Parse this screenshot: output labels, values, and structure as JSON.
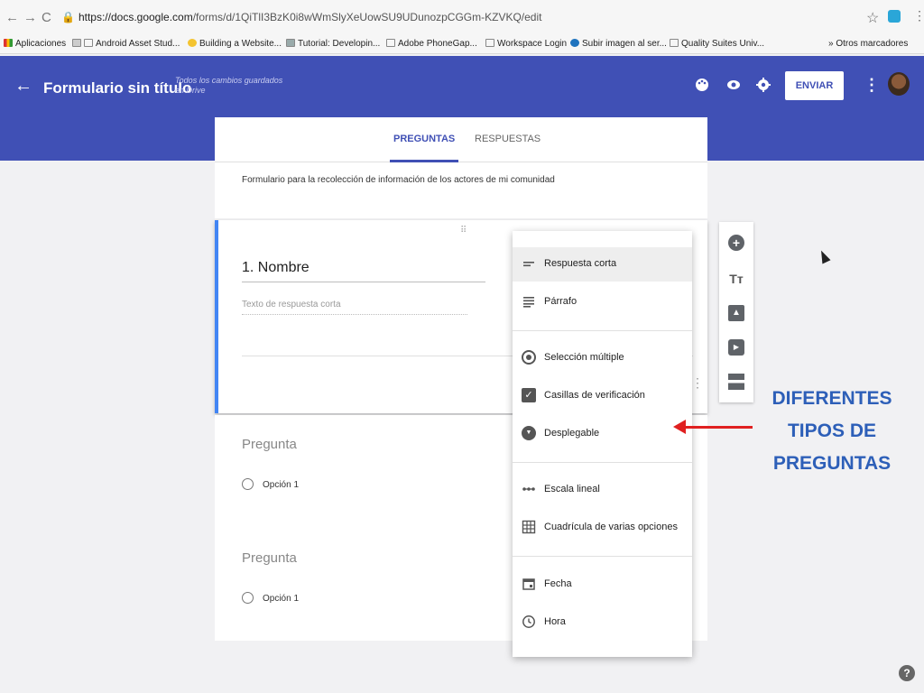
{
  "browser": {
    "url_host": "https://docs.google.com",
    "url_path": "/forms/d/1QiTlI3BzK0i8wWmSlyXeUowSU9UDunozpCGGm-KZVKQ/edit",
    "lock": "🔒",
    "star": "☆",
    "menu": "⋮",
    "nav_back": "←",
    "nav_forward": "→",
    "nav_reload": "C",
    "bookmarks": [
      {
        "label": "Aplicaciones"
      },
      {
        "label": "Android Asset Stud..."
      },
      {
        "label": "Building a Website..."
      },
      {
        "label": "Tutorial: Developin..."
      },
      {
        "label": "Adobe PhoneGap..."
      },
      {
        "label": "Workspace Login"
      },
      {
        "label": "Subir imagen al ser..."
      },
      {
        "label": "Quality Suites Univ..."
      }
    ],
    "other_bookmarks": "» Otros marcadores"
  },
  "header": {
    "back": "←",
    "title": "Formulario sin título",
    "saved_status": "Todos los cambios guardados en Drive",
    "send_label": "ENVIAR",
    "more": "⋮",
    "palette_icon": "palette",
    "preview_icon": "eye",
    "settings_icon": "gear"
  },
  "tabs": {
    "questions": "PREGUNTAS",
    "responses": "RESPUESTAS"
  },
  "form": {
    "description": "Formulario para la recolección de información de los actores de mi comunidad"
  },
  "question1": {
    "title": "1. Nombre",
    "placeholder": "Texto de respuesta corta",
    "drag": "⠿"
  },
  "question2": {
    "title": "Pregunta",
    "option": "Opción 1"
  },
  "question3": {
    "title": "Pregunta",
    "option": "Opción 1"
  },
  "question_types": [
    {
      "label": "Respuesta corta",
      "icon": "short-answer",
      "selected": true
    },
    {
      "label": "Párrafo",
      "icon": "paragraph"
    },
    {
      "label": "Selección múltiple",
      "icon": "radio"
    },
    {
      "label": "Casillas de verificación",
      "icon": "checkbox"
    },
    {
      "label": "Desplegable",
      "icon": "dropdown"
    },
    {
      "label": "Escala lineal",
      "icon": "linear-scale"
    },
    {
      "label": "Cuadrícula de varias opciones",
      "icon": "grid"
    },
    {
      "label": "Fecha",
      "icon": "calendar"
    },
    {
      "label": "Hora",
      "icon": "clock"
    }
  ],
  "side_toolbar": {
    "add": "+",
    "title_text": "Tт",
    "image": "▲",
    "video": "▶"
  },
  "annotation": {
    "line1": "DIFERENTES",
    "line2": "TIPOS DE",
    "line3": "PREGUNTAS",
    "color": "#2d5fb8",
    "arrow_color": "#e02020"
  },
  "help": "?",
  "colors": {
    "header": "#4050b5",
    "accent": "#4285f4"
  }
}
